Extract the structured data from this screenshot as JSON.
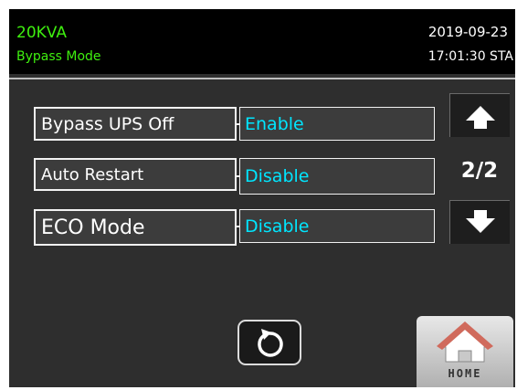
{
  "header": {
    "model": "20KVA",
    "mode": "Bypass Mode",
    "date": "2019-09-23",
    "time": "17:01:30 STA"
  },
  "settings": [
    {
      "label": "Bypass UPS Off",
      "value": "Enable"
    },
    {
      "label": "Auto Restart",
      "value": "Disable"
    },
    {
      "label": "ECO Mode",
      "value": "Disable"
    }
  ],
  "pagination": {
    "indicator": "2/2"
  },
  "buttons": {
    "up_icon": "arrow-up-icon",
    "down_icon": "arrow-down-icon",
    "back_icon": "refresh-back-icon",
    "home_label": "HOME",
    "home_icon": "home-icon"
  },
  "colors": {
    "status_text": "#3ff00f",
    "value_text": "#00e6ff",
    "background": "#2e2e2e",
    "header_background": "#000000"
  }
}
